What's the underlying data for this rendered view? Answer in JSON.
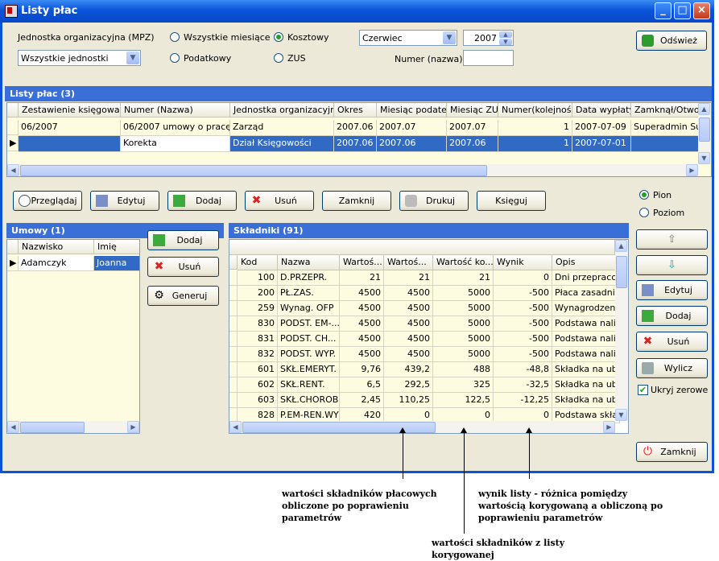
{
  "window": {
    "title": "Listy płac"
  },
  "filters": {
    "unit_label": "Jednostka organizacyjna (MPZ)",
    "unit_value": "Wszystkie jednostki",
    "radio_all_months": "Wszystkie miesiące",
    "radio_tax": "Podatkowy",
    "radio_cost": "Kosztowy",
    "radio_zus": "ZUS",
    "month_value": "Czerwiec",
    "year_value": "2007",
    "number_label": "Numer (nazwa)",
    "number_value": "",
    "refresh_label": "Odśwież"
  },
  "payrolls": {
    "header": "Listy płac (3)",
    "columns": [
      "Zestawienie księgowań",
      "Numer (Nazwa)",
      "Jednostka organizacyjna",
      "Okres",
      "Miesiąc podatek",
      "Miesiąc ZUS",
      "Numer(kolejność)",
      "Data wypłaty",
      "Zamknął/Otworzył"
    ],
    "rows": [
      [
        "06/2007",
        "06/2007 umowy o pracę",
        "Zarząd",
        "2007.06",
        "2007.07",
        "2007.07",
        "1",
        "2007-07-09",
        "Superadmin Sup."
      ],
      [
        "",
        "Korekta",
        "Dział Księgowości",
        "2007.06",
        "2007.06",
        "2007.06",
        "1",
        "2007-07-01",
        ""
      ]
    ]
  },
  "actions": {
    "browse": "Przeglądaj",
    "edit": "Edytuj",
    "add": "Dodaj",
    "delete": "Usuń",
    "close_list": "Zamknij",
    "print": "Drukuj",
    "book": "Księguj",
    "orient_vertical": "Pion",
    "orient_horizontal": "Poziom"
  },
  "contracts": {
    "header": "Umowy (1)",
    "columns": [
      "Nazwisko",
      "Imię"
    ],
    "rows": [
      [
        "Adamczyk",
        "Joanna"
      ]
    ],
    "add": "Dodaj",
    "delete": "Usuń",
    "generate": "Generuj"
  },
  "components": {
    "header": "Składniki (91)",
    "columns": [
      "Kod",
      "Nazwa",
      "Wartoś...",
      "Wartoś...",
      "Wartość ko...",
      "Wynik",
      "Opis"
    ],
    "rows": [
      [
        "100",
        "D.PRZEPR.",
        "21",
        "21",
        "21",
        "0",
        "Dni przepracowane"
      ],
      [
        "200",
        "PŁ.ZAS.",
        "4500",
        "4500",
        "5000",
        "-500",
        "Płaca zasadnicza"
      ],
      [
        "259",
        "Wynag. OFP",
        "4500",
        "4500",
        "5000",
        "-500",
        "Wynagrodzenia O"
      ],
      [
        "830",
        "PODST. EM-...",
        "4500",
        "4500",
        "5000",
        "-500",
        "Podstawa nalicze"
      ],
      [
        "831",
        "PODST. CH...",
        "4500",
        "4500",
        "5000",
        "-500",
        "Podstawa nalicze"
      ],
      [
        "832",
        "PODST. WYP.",
        "4500",
        "4500",
        "5000",
        "-500",
        "Podstawa nalicze"
      ],
      [
        "601",
        "SKŁ.EMERYT.",
        "9,76",
        "439,2",
        "488",
        "-48,8",
        "Składka na ubezp"
      ],
      [
        "602",
        "SKŁ.RENT.",
        "6,5",
        "292,5",
        "325",
        "-32,5",
        "Składka na ubezp"
      ],
      [
        "603",
        "SKŁ.CHOROB.",
        "2,45",
        "110,25",
        "122,5",
        "-12,25",
        "Składka na ubezp"
      ],
      [
        "828",
        "P.EM-REN.WY",
        "420",
        "0",
        "0",
        "0",
        "Podstawa składek"
      ]
    ],
    "edit": "Edytuj",
    "add": "Dodaj",
    "delete": "Usuń",
    "calc": "Wylicz",
    "hide_zero": "Ukryj zerowe",
    "close": "Zamknij"
  },
  "annotations": {
    "a1": "wartości składników płacowych obliczone po poprawieniu parametrów",
    "a2": "wynik listy - różnica pomiędzy wartością korygowaną a obliczoną po poprawieniu parametrów",
    "a3": "wartości składników z listy korygowanej"
  }
}
